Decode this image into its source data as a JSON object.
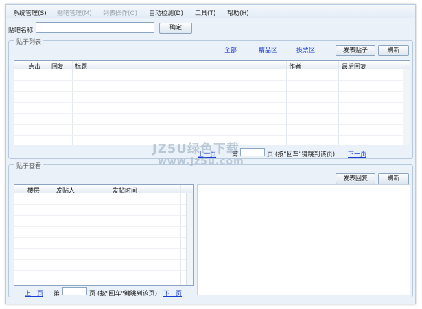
{
  "menu": {
    "items": [
      {
        "label": "系统管理(S)",
        "enabled": true
      },
      {
        "label": "贴吧管理(M)",
        "enabled": false
      },
      {
        "label": "列表操作(O)",
        "enabled": false
      },
      {
        "label": "自动检测(D)",
        "enabled": true
      },
      {
        "label": "工具(T)",
        "enabled": true
      },
      {
        "label": "帮助(H)",
        "enabled": true
      }
    ]
  },
  "forum": {
    "label": "贴吧名称:",
    "value": "",
    "confirm_label": "确定"
  },
  "post_list": {
    "title": "贴子列表",
    "filters": [
      "全部",
      "精品区",
      "投票区"
    ],
    "new_post_label": "发表贴子",
    "refresh_label": "刷新",
    "columns": [
      "点击",
      "回复",
      "标题",
      "作者",
      "最后回复"
    ],
    "pager": {
      "prev": "上一页",
      "page_prefix": "第",
      "page_value": "",
      "page_suffix": "页 (按\"回车\"键跳到该页)",
      "next": "下一页"
    }
  },
  "post_view": {
    "title": "贴子查看",
    "reply_label": "发表回复",
    "refresh_label": "刷新",
    "columns": [
      "楼层",
      "发贴人",
      "发帖时间"
    ],
    "pager": {
      "prev": "上一页",
      "page_prefix": "第",
      "page_value": "",
      "page_suffix": "页 (按\"回车\"键跳到该页)",
      "next": "下一页"
    }
  },
  "watermark": {
    "line1": "JZ5U绿色下载",
    "line2": "www.jz5u.com"
  },
  "colors": {
    "accent_link": "#1a3fd0",
    "window_bg": "#eaf1f9",
    "border": "#8aa6c4"
  }
}
